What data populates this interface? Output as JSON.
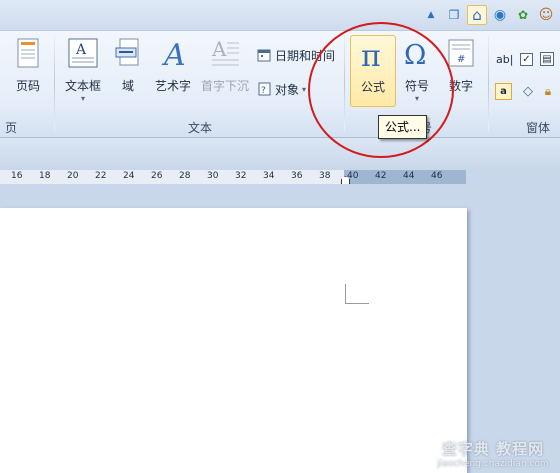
{
  "top_icons": [
    {
      "name": "up-arrow-icon",
      "glyph": "▲"
    },
    {
      "name": "window-restore-icon",
      "glyph": "❐"
    },
    {
      "name": "home-icon",
      "glyph": "⌂"
    },
    {
      "name": "globe-icon",
      "glyph": "◉"
    },
    {
      "name": "plant-icon",
      "glyph": "✿"
    },
    {
      "name": "user-icon",
      "glyph": "☺"
    }
  ],
  "ribbon": {
    "page_number_label": "页码",
    "header_footer_group": "页脚",
    "text_group": {
      "label": "文本",
      "textbox_label": "文本框",
      "field_label": "域",
      "wordart_label": "艺术字",
      "dropcap_label": "首字下沉",
      "datetime_label": "日期和时间",
      "object_label": "对象"
    },
    "symbols_group": {
      "label": "符号",
      "formula_label": "公式",
      "symbol_label": "符号",
      "number_label": "数字"
    },
    "controls_group": {
      "label": "窗体",
      "text_field_icon": "ab|"
    }
  },
  "tooltip": "公式...",
  "ruler_ticks": [
    "16",
    "18",
    "20",
    "22",
    "24",
    "26",
    "28",
    "30",
    "32",
    "34",
    "36",
    "38",
    "40",
    "42",
    "44",
    "46"
  ],
  "watermark": {
    "line1": "查字典 教程网",
    "line2": "jiaocheng.chazidian.com"
  },
  "colors": {
    "highlight_circle": "#d41a1a",
    "ribbon_bg": "#e4edf8",
    "hover_bg": "#ffe9a6"
  }
}
